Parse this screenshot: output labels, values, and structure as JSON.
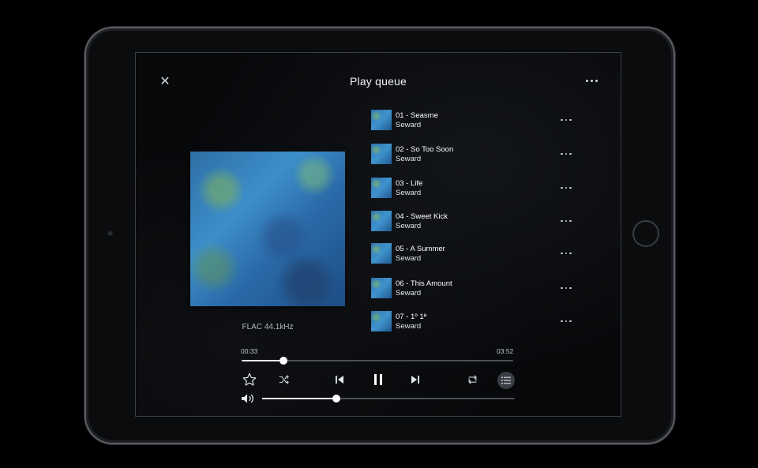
{
  "header": {
    "close_icon": "close-icon",
    "title": "Play queue",
    "more_icon": "more-horizontal-icon"
  },
  "now_playing": {
    "format": "FLAC 44.1kHz",
    "elapsed": "00:33",
    "total": "03:52",
    "progress_fraction": 0.155
  },
  "queue": [
    {
      "title": "01 - Seasme",
      "artist": "Seward"
    },
    {
      "title": "02 - So Too Soon",
      "artist": "Seward"
    },
    {
      "title": "03 - Life",
      "artist": "Seward"
    },
    {
      "title": "04 - Sweet Kick",
      "artist": "Seward"
    },
    {
      "title": "05 - A Summer",
      "artist": "Seward"
    },
    {
      "title": "06 - This Amount",
      "artist": "Seward"
    },
    {
      "title": "07 - 1º 1ª",
      "artist": "Seward"
    }
  ],
  "controls": {
    "favorite_icon": "star-icon",
    "shuffle_icon": "shuffle-icon",
    "previous_icon": "skip-previous-icon",
    "play_pause_icon": "pause-icon",
    "next_icon": "skip-next-icon",
    "repeat_icon": "repeat-icon",
    "queue_icon": "queue-list-icon"
  },
  "volume": {
    "icon": "volume-icon",
    "level_fraction": 0.295
  },
  "colors": {
    "background": "#07080a",
    "accent": "#ffffff",
    "track_inactive": "#4b4f55"
  }
}
